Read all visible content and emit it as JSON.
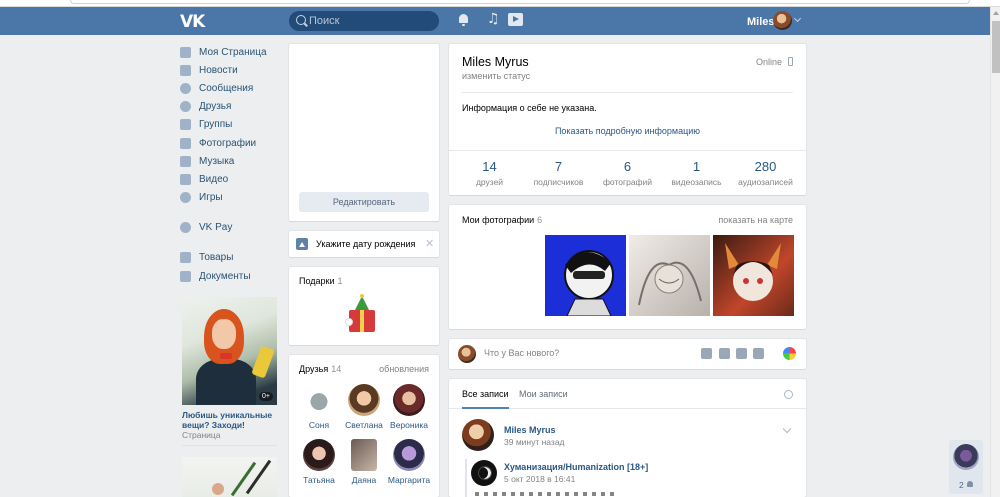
{
  "header": {
    "logo": "VK",
    "search_placeholder": "Поиск",
    "user_name": "Miles"
  },
  "menu": {
    "items": [
      {
        "label": "Моя Страница",
        "icon": "home-icon"
      },
      {
        "label": "Новости",
        "icon": "news-icon"
      },
      {
        "label": "Сообщения",
        "icon": "messages-icon"
      },
      {
        "label": "Друзья",
        "icon": "friends-icon"
      },
      {
        "label": "Группы",
        "icon": "groups-icon"
      },
      {
        "label": "Фотографии",
        "icon": "camera-icon"
      },
      {
        "label": "Музыка",
        "icon": "music-icon"
      },
      {
        "label": "Видео",
        "icon": "video-icon"
      },
      {
        "label": "Игры",
        "icon": "gamepad-icon"
      },
      {
        "label": "VK Pay",
        "icon": "vkpay-icon"
      },
      {
        "label": "Товары",
        "icon": "bag-icon"
      },
      {
        "label": "Документы",
        "icon": "document-icon"
      }
    ]
  },
  "ad": {
    "badge": "0+",
    "title": "Любишь уникальные вещи? Заходи!",
    "subtitle": "Страница"
  },
  "profile": {
    "edit_button": "Редактировать",
    "birthday_prompt": "Укажите дату рождения",
    "name": "Miles Myrus",
    "status": "изменить статус",
    "online": "Online",
    "info": "Информация о себе не указана.",
    "more_info": "Показать подробную информацию",
    "stats": [
      {
        "num": "14",
        "label": "друзей"
      },
      {
        "num": "7",
        "label": "подписчиков"
      },
      {
        "num": "6",
        "label": "фотографий"
      },
      {
        "num": "1",
        "label": "видеозапись"
      },
      {
        "num": "280",
        "label": "аудиозаписей"
      }
    ]
  },
  "gifts": {
    "title": "Подарки",
    "count": "1"
  },
  "friends": {
    "title": "Друзья",
    "count": "14",
    "updates": "обновления",
    "list": [
      {
        "name": "Соня"
      },
      {
        "name": "Светлана"
      },
      {
        "name": "Вероника"
      },
      {
        "name": "Татьяна"
      },
      {
        "name": "Даяна"
      },
      {
        "name": "Маргарита"
      }
    ]
  },
  "photos": {
    "title": "Мои фотографии",
    "count": "6",
    "map_link": "показать на карте"
  },
  "composer": {
    "placeholder": "Что у Вас нового?"
  },
  "wall": {
    "tab_all": "Все записи",
    "tab_mine": "Мои записи",
    "post": {
      "author": "Miles Myrus",
      "time": "39 минут назад",
      "repost_name": "Хуманизация/Humanization [18+]",
      "repost_time": "5 окт 2018 в 16:41"
    }
  },
  "widget": {
    "count": "2"
  }
}
